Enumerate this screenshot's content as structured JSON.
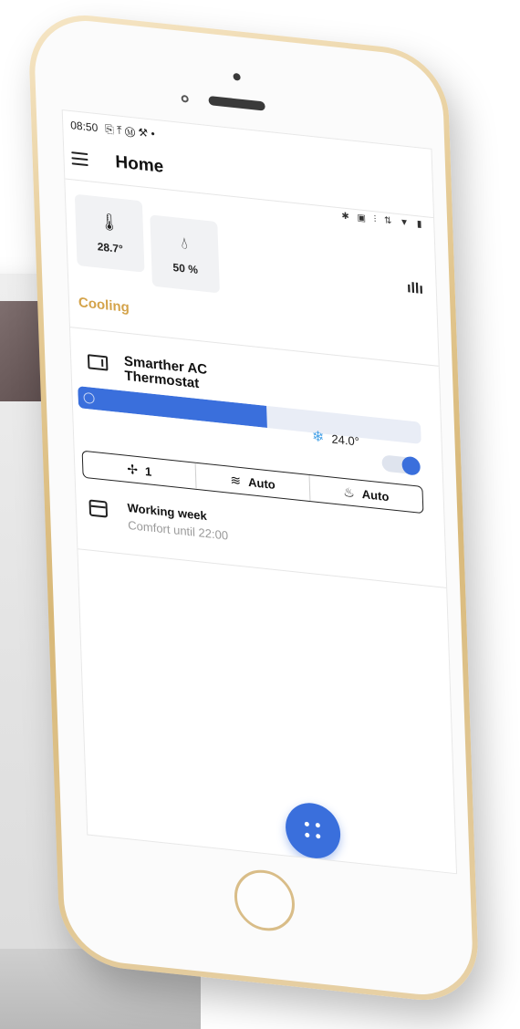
{
  "status_bar": {
    "time": "08:50",
    "left_icons": "⎘ ⤒ Ⓜ ⚒ •",
    "right_icons": "✱ ▣ ⫶ ⇅ ▼ ▮"
  },
  "app_bar": {
    "title": "Home",
    "menu_icon": "hamburger-icon"
  },
  "sensors": {
    "temperature": {
      "icon": "thermometer-icon",
      "value": "28.7°"
    },
    "humidity": {
      "icon": "droplet-icon",
      "value": "50 %"
    },
    "chart_icon": "bar-chart-icon"
  },
  "mode_label": "Cooling",
  "device": {
    "name": "Smarther AC Thermostat",
    "icon": "air-conditioner-icon",
    "slider_fraction": 0.55,
    "setpoint": "24.0°",
    "setpoint_icon": "snowflake-icon",
    "power_on": true
  },
  "controls": {
    "fan_speed": {
      "icon": "fan-icon",
      "value": "1"
    },
    "swing": {
      "icon": "swing-icon",
      "value": "Auto"
    },
    "mode": {
      "icon": "heat-waves-icon",
      "value": "Auto"
    }
  },
  "schedule": {
    "title": "Working week",
    "subtitle": "Comfort until 22:00",
    "icon": "calendar-icon"
  },
  "colors": {
    "accent_blue": "#3a6fdc",
    "cooling_label": "#d4a34a",
    "snowflake": "#4ba4e8",
    "phone_gold": "#d8b878"
  }
}
